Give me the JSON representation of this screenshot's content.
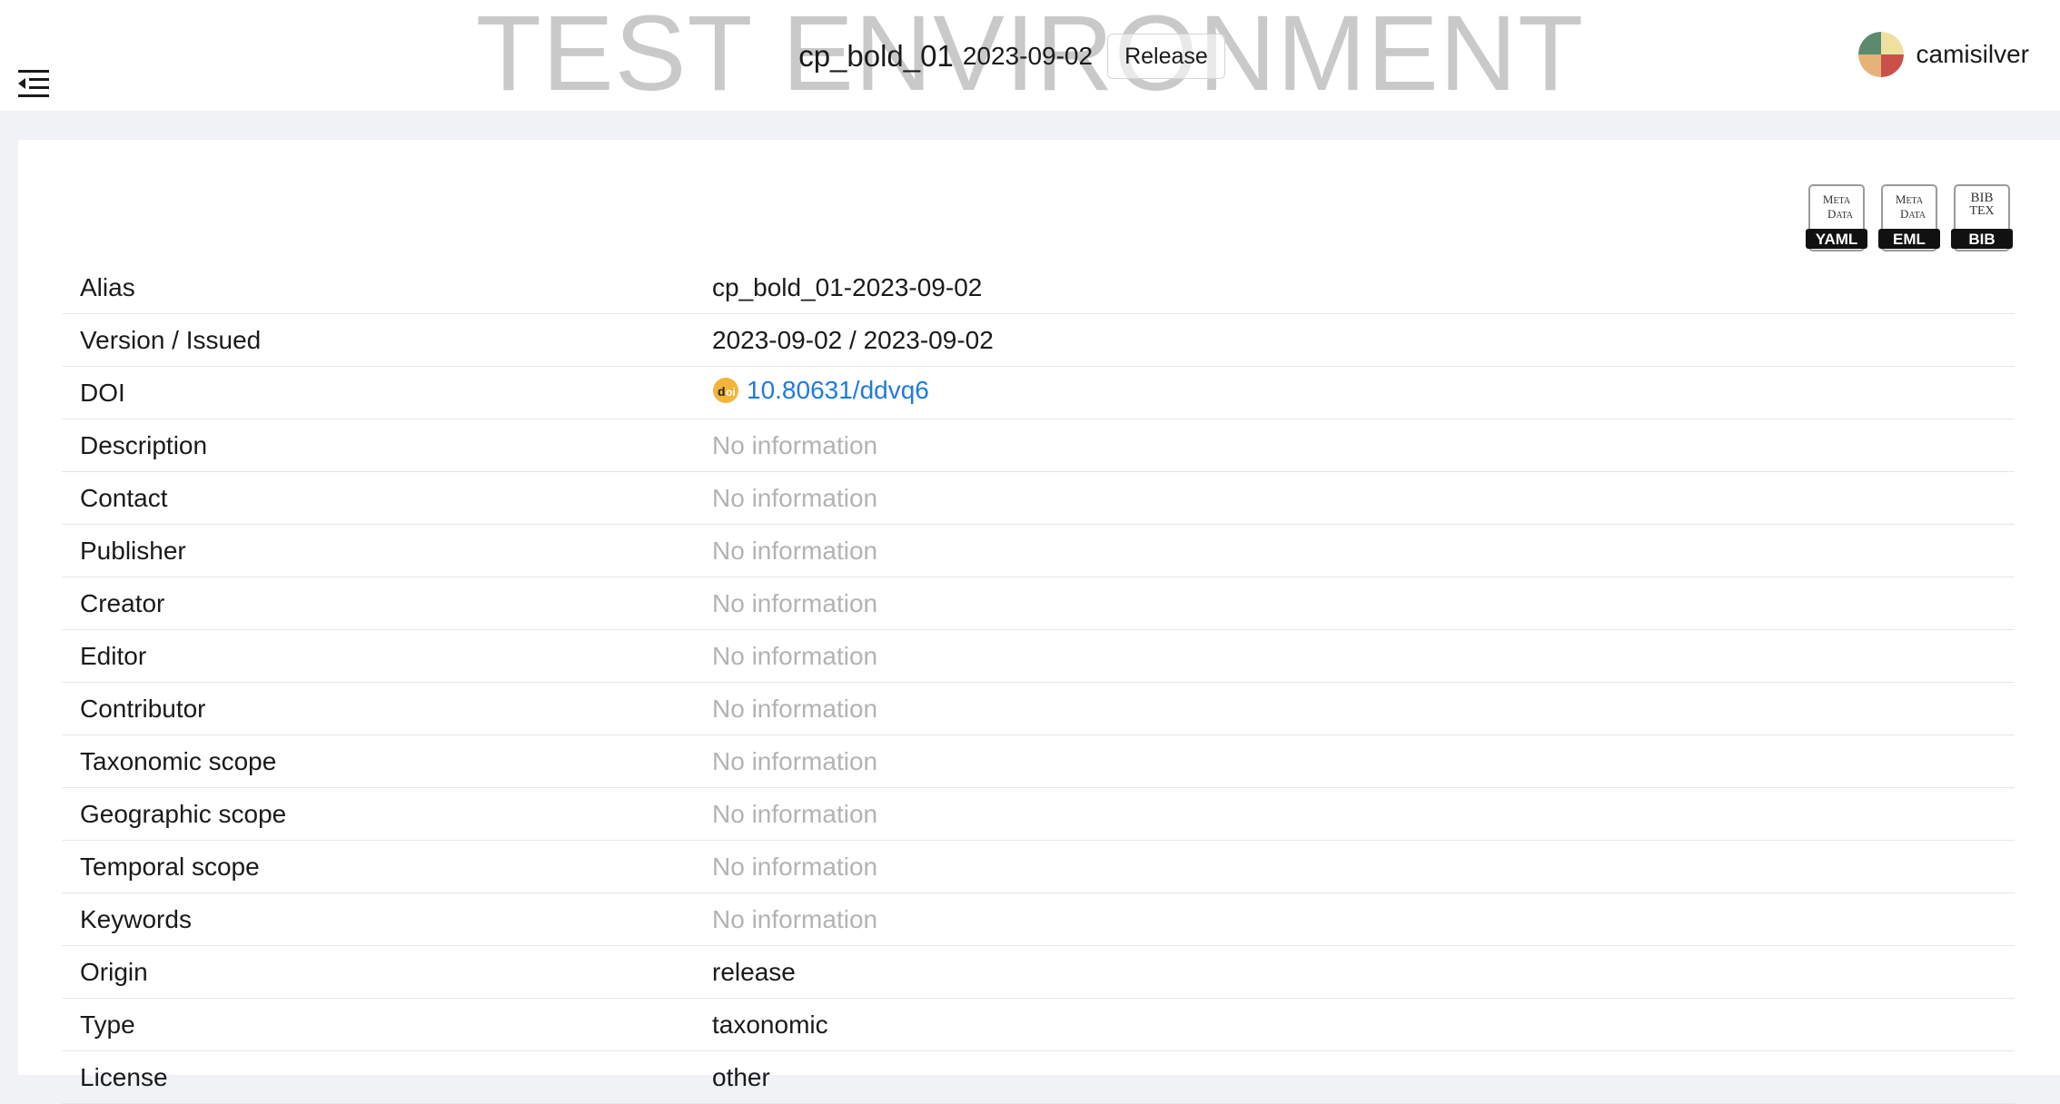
{
  "header": {
    "environment_banner": "TEST ENVIRONMENT",
    "dataset_name": "cp_bold_01",
    "dataset_version": "2023-09-02",
    "release_label": "Release",
    "username": "camisilver"
  },
  "downloads": [
    {
      "top_line": "Meta",
      "bottom_line": "Data",
      "format": "YAML",
      "icon": "yaml-download-icon"
    },
    {
      "top_line": "Meta",
      "bottom_line": "Data",
      "format": "EML",
      "icon": "eml-download-icon"
    },
    {
      "top_line": "BibTeX",
      "bottom_line": "",
      "format": "BIB",
      "icon": "bibtex-download-icon"
    }
  ],
  "metadata": {
    "alias": {
      "label": "Alias",
      "value": "cp_bold_01-2023-09-02"
    },
    "version": {
      "label": "Version / Issued",
      "value": "2023-09-02 / 2023-09-02"
    },
    "doi": {
      "label": "DOI",
      "value": "10.80631/ddvq6"
    },
    "description": {
      "label": "Description",
      "value": "No information"
    },
    "contact": {
      "label": "Contact",
      "value": "No information"
    },
    "publisher": {
      "label": "Publisher",
      "value": "No information"
    },
    "creator": {
      "label": "Creator",
      "value": "No information"
    },
    "editor": {
      "label": "Editor",
      "value": "No information"
    },
    "contributor": {
      "label": "Contributor",
      "value": "No information"
    },
    "taxonomic_scope": {
      "label": "Taxonomic scope",
      "value": "No information"
    },
    "geographic_scope": {
      "label": "Geographic scope",
      "value": "No information"
    },
    "temporal_scope": {
      "label": "Temporal scope",
      "value": "No information"
    },
    "keywords": {
      "label": "Keywords",
      "value": "No information"
    },
    "origin": {
      "label": "Origin",
      "value": "release"
    },
    "type": {
      "label": "Type",
      "value": "taxonomic"
    },
    "license": {
      "label": "License",
      "value": "other"
    }
  },
  "colors": {
    "link": "#1f7ae0",
    "placeholder": "#b3b3b3",
    "banner": "#c9c9c9",
    "page_bg": "#f0f2f5"
  }
}
